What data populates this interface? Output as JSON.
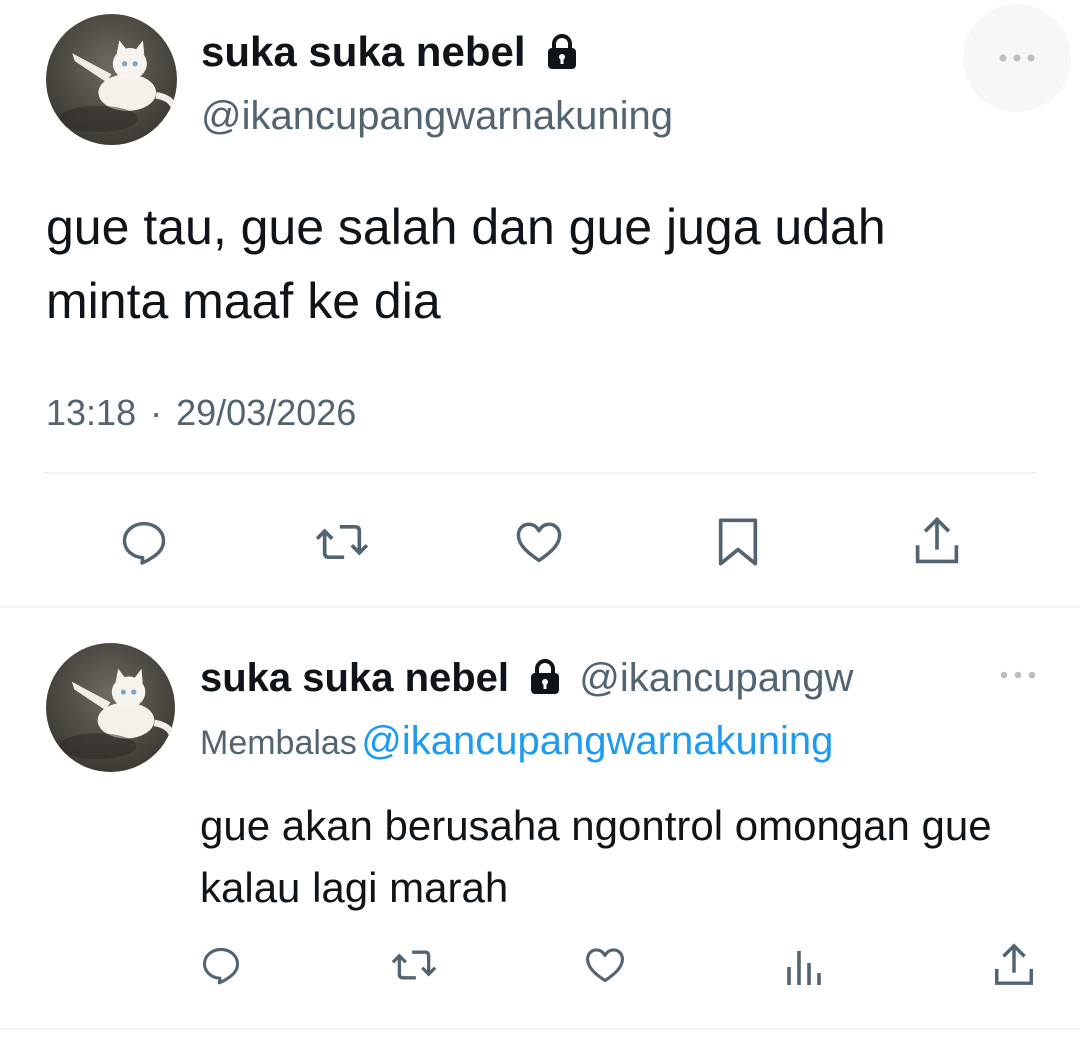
{
  "main_tweet": {
    "display_name": "suka suka nebel",
    "handle": "@ikancupangwarnakuning",
    "text": "gue tau, gue salah dan gue juga udah minta maaf ke dia",
    "time": "13:18",
    "date": "29/03/2026",
    "separator": "·",
    "actions": [
      "reply-icon",
      "retweet-icon",
      "like-icon",
      "bookmark-icon",
      "share-icon"
    ]
  },
  "reply_tweet": {
    "display_name": "suka suka nebel",
    "handle": "@ikancupangw",
    "replying_prefix": "Membalas",
    "replying_to": "@ikancupangwarnakuning",
    "text": "gue akan berusaha ngontrol omongan gue kalau lagi marah",
    "actions": [
      "reply-icon",
      "retweet-icon",
      "like-icon",
      "views-icon",
      "share-icon"
    ]
  },
  "colors": {
    "text_primary": "#0f1419",
    "text_secondary": "#536471",
    "link": "#1d9bf0",
    "divider": "#eff3f4"
  }
}
